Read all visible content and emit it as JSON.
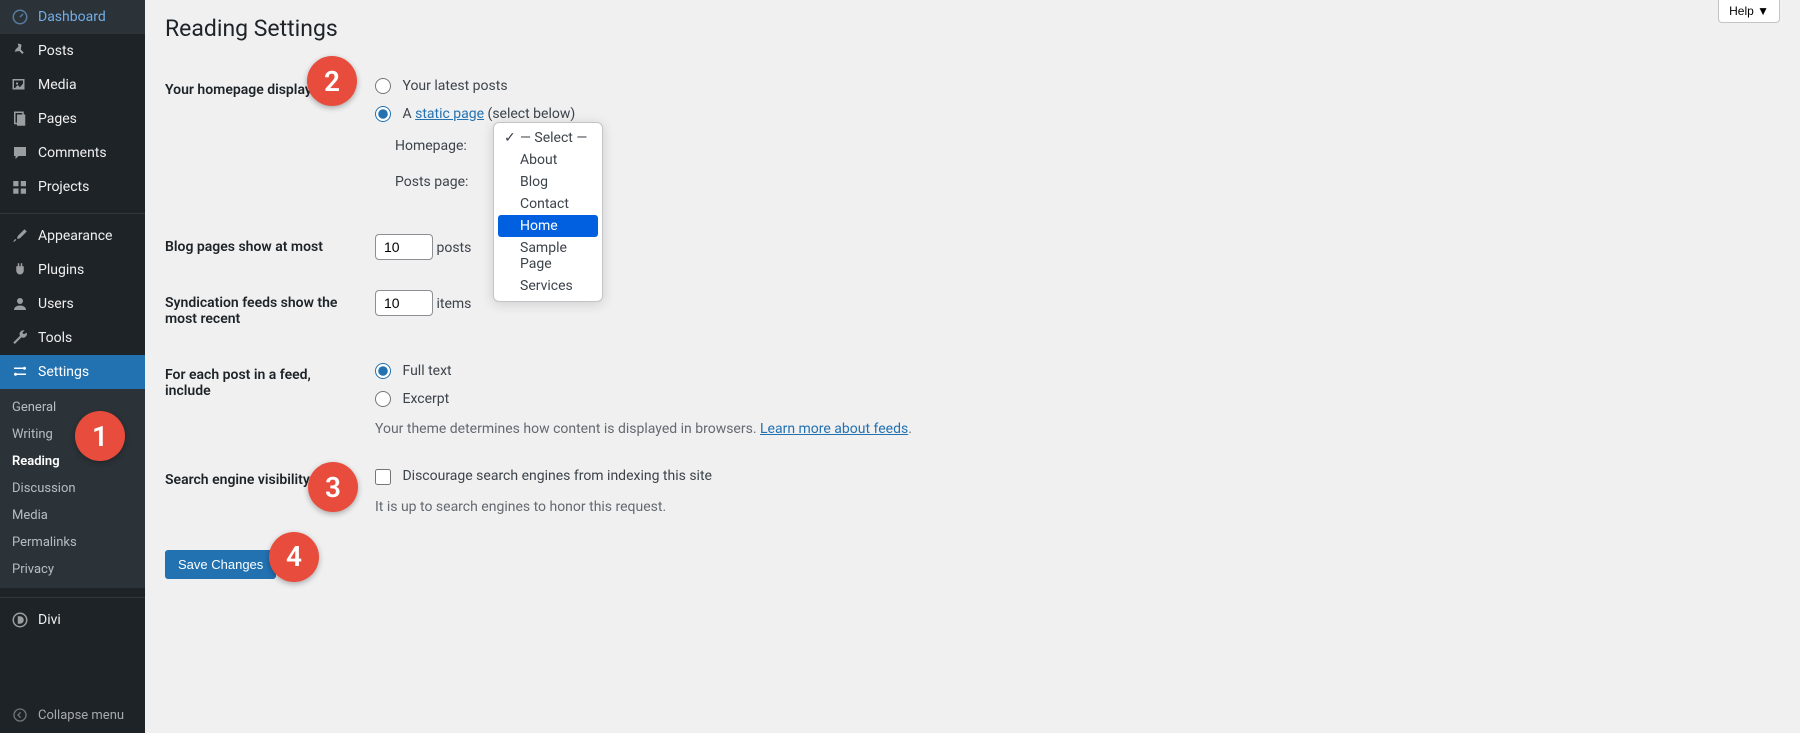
{
  "sidebar": {
    "dashboard": "Dashboard",
    "posts": "Posts",
    "media": "Media",
    "pages": "Pages",
    "comments": "Comments",
    "projects": "Projects",
    "appearance": "Appearance",
    "plugins": "Plugins",
    "users": "Users",
    "tools": "Tools",
    "settings": "Settings",
    "divi": "Divi",
    "collapse": "Collapse menu"
  },
  "submenu": {
    "general": "General",
    "writing": "Writing",
    "reading": "Reading",
    "discussion": "Discussion",
    "media": "Media",
    "permalinks": "Permalinks",
    "privacy": "Privacy"
  },
  "header": {
    "help": "Help ▼",
    "title": "Reading Settings"
  },
  "form": {
    "homepage_displays_label": "Your homepage displays",
    "latest_posts": "Your latest posts",
    "static_page_prefix": "A ",
    "static_page_link": "static page",
    "static_page_suffix": " (select below)",
    "homepage_label": "Homepage:",
    "posts_page_label": "Posts page:",
    "blog_pages_label": "Blog pages show at most",
    "blog_pages_value": "10",
    "blog_pages_suffix": "posts",
    "syndication_label": "Syndication feeds show the most recent",
    "syndication_value": "10",
    "syndication_suffix": "items",
    "feed_include_label": "For each post in a feed, include",
    "full_text": "Full text",
    "excerpt": "Excerpt",
    "theme_desc_prefix": "Your theme determines how content is displayed in browsers. ",
    "theme_desc_link": "Learn more about feeds",
    "theme_desc_suffix": ".",
    "visibility_label": "Search engine visibility",
    "discourage": "Discourage search engines from indexing this site",
    "honor_note": "It is up to search engines to honor this request.",
    "save": "Save Changes"
  },
  "dropdown": {
    "options": [
      "— Select —",
      "About",
      "Blog",
      "Contact",
      "Home",
      "Sample Page",
      "Services"
    ]
  },
  "annotations": {
    "n1": "1",
    "n2": "2",
    "n3": "3",
    "n4": "4"
  }
}
